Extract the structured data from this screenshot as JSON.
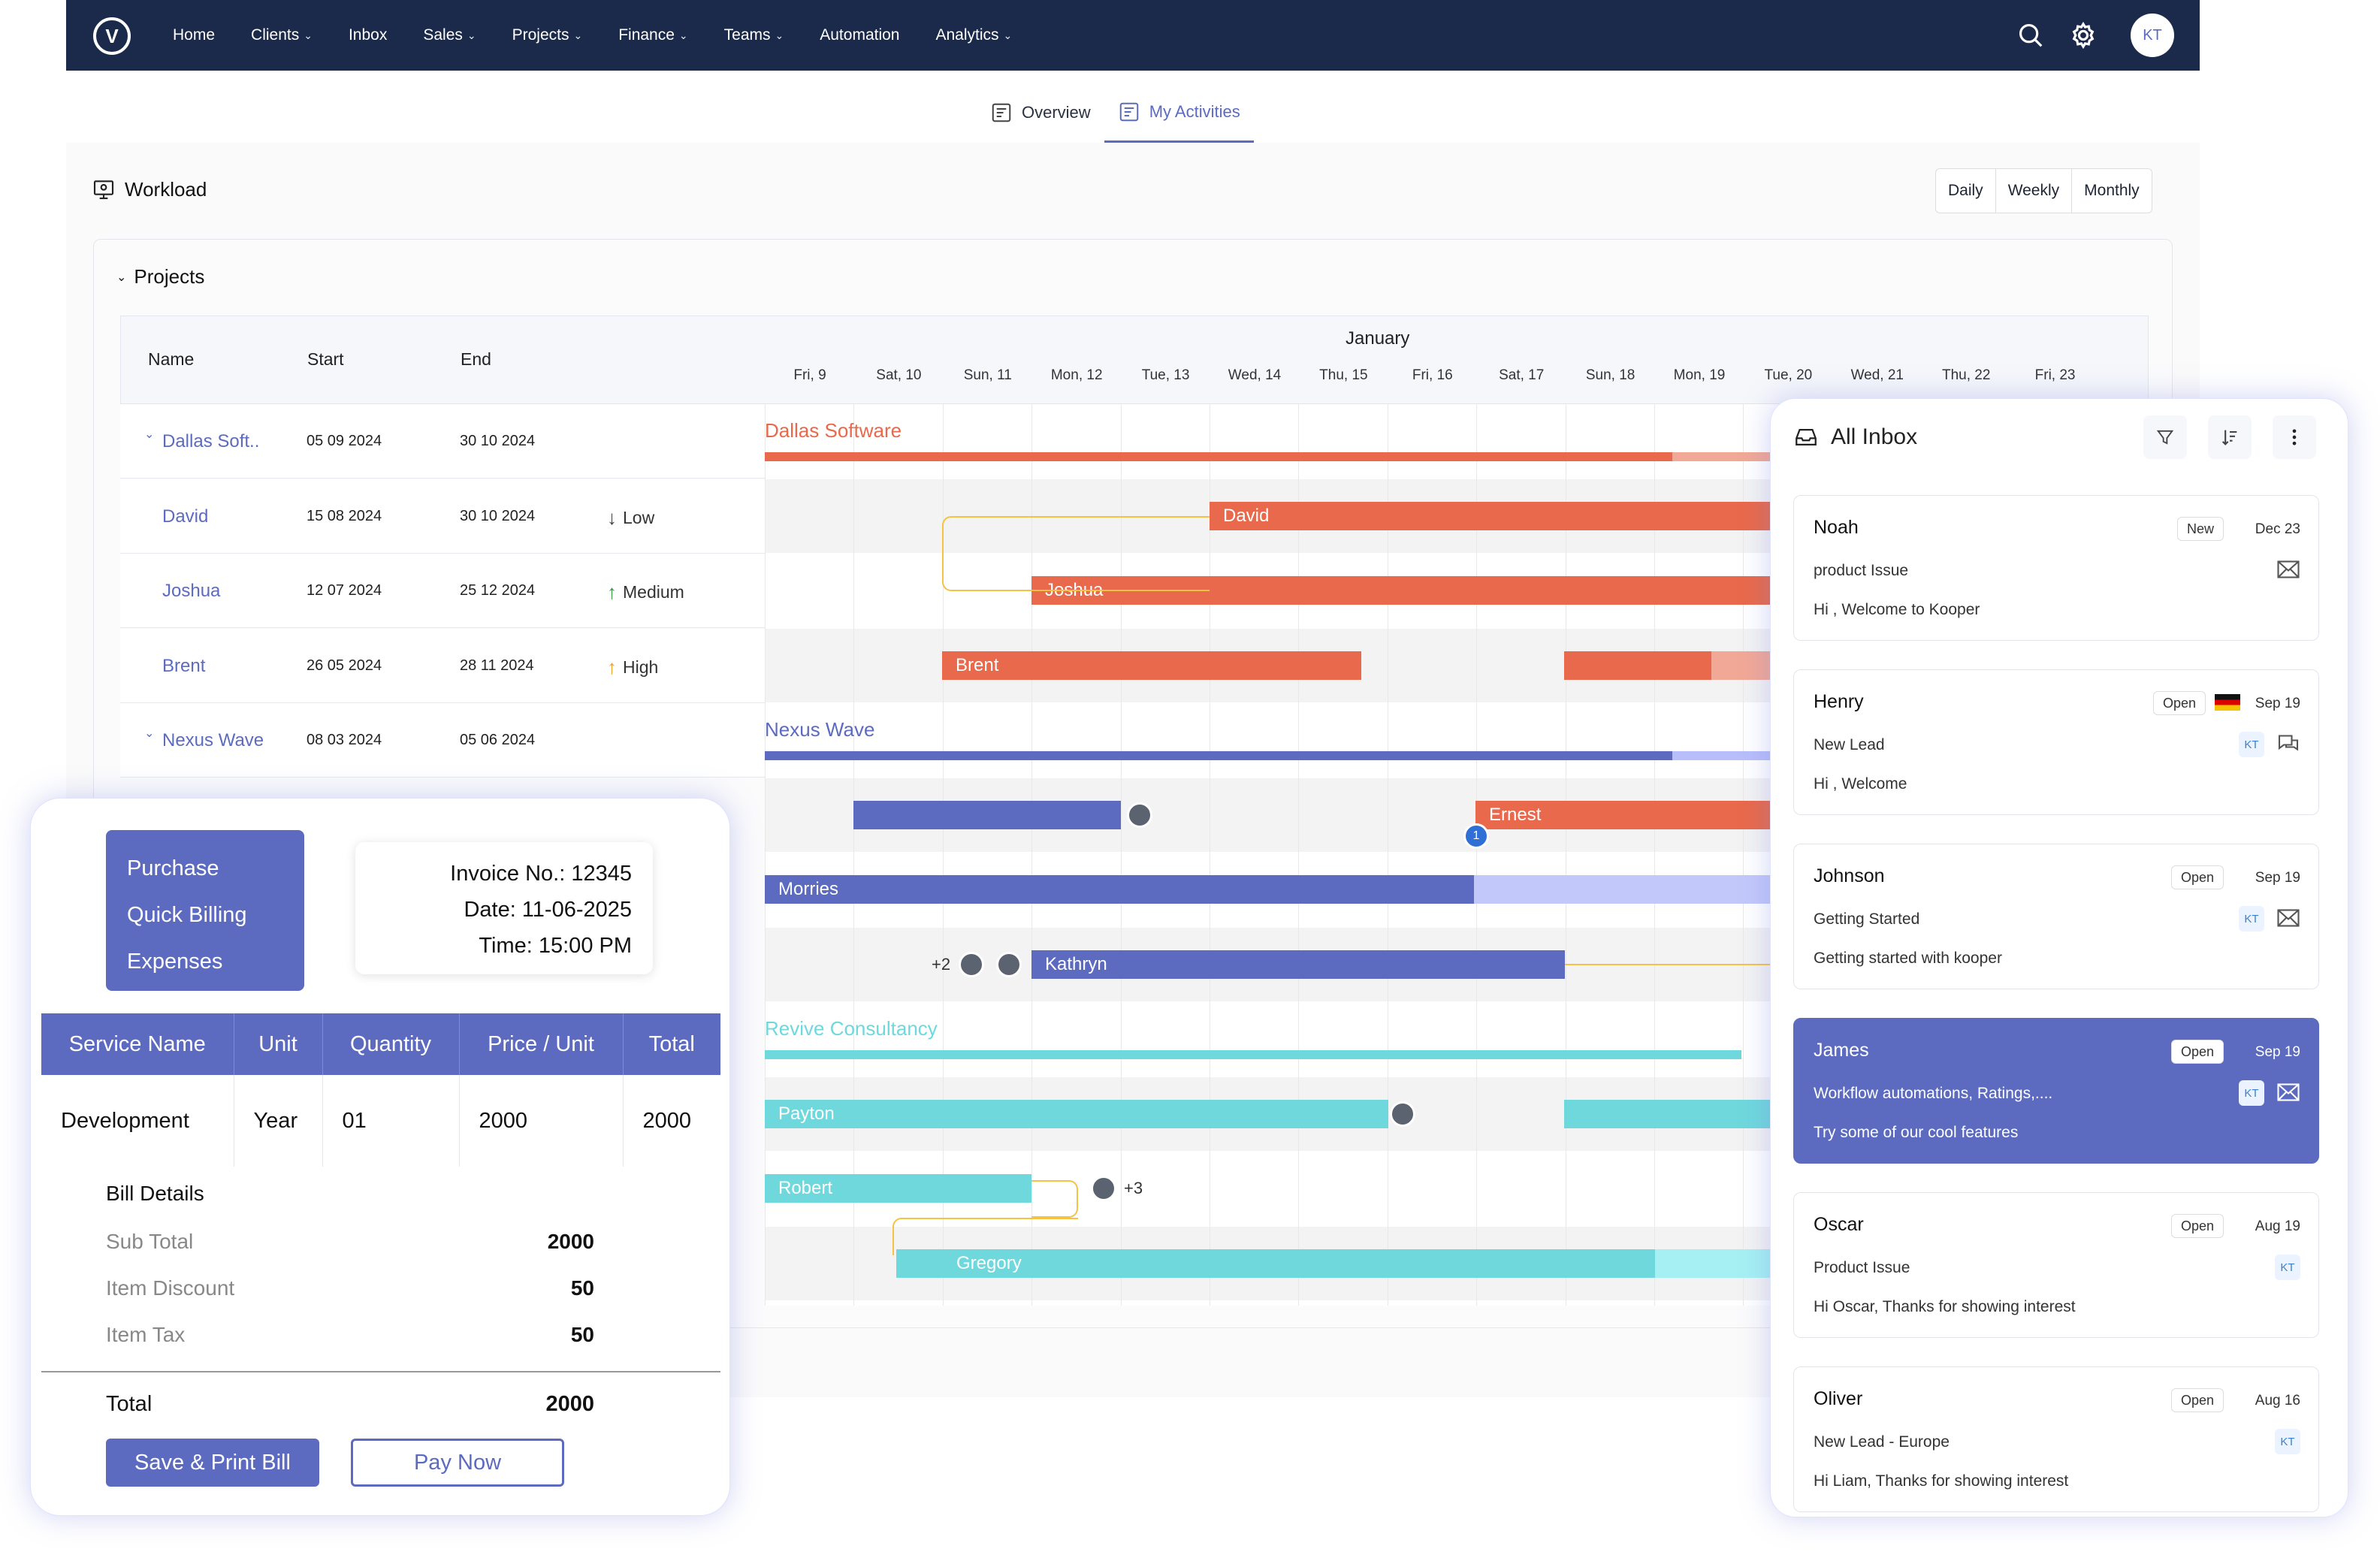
{
  "nav": {
    "logo": "V",
    "items": [
      {
        "label": "Home",
        "dropdown": false
      },
      {
        "label": "Clients",
        "dropdown": true
      },
      {
        "label": "Inbox",
        "dropdown": false
      },
      {
        "label": "Sales",
        "dropdown": true
      },
      {
        "label": "Projects",
        "dropdown": true
      },
      {
        "label": "Finance",
        "dropdown": true
      },
      {
        "label": "Teams",
        "dropdown": true
      },
      {
        "label": "Automation",
        "dropdown": false
      },
      {
        "label": "Analytics",
        "dropdown": true
      }
    ],
    "avatar": "KT"
  },
  "tabs": {
    "overview": "Overview",
    "activities": "My Activities"
  },
  "workload": {
    "title": "Workload",
    "periods": [
      "Daily",
      "Weekly",
      "Monthly"
    ],
    "projects_title": "Projects"
  },
  "gantt": {
    "headers": {
      "name": "Name",
      "start": "Start",
      "end": "End"
    },
    "month": "January",
    "days": [
      "Fri, 9",
      "Sat, 10",
      "Sun, 11",
      "Mon, 12",
      "Tue, 13",
      "Wed, 14",
      "Thu, 15",
      "Fri, 16",
      "Sat, 17",
      "Sun, 18",
      "Mon, 19",
      "Tue, 20",
      "Wed, 21",
      "Thu, 22",
      "Fri, 23"
    ],
    "rows": [
      {
        "name": "Dallas Soft..",
        "start": "05 09 2024",
        "end": "30 10 2024",
        "priority": "",
        "group": true
      },
      {
        "name": "David",
        "start": "15 08 2024",
        "end": "30 10 2024",
        "priority": "Low",
        "group": false
      },
      {
        "name": "Joshua",
        "start": "12 07 2024",
        "end": "25 12 2024",
        "priority": "Medium",
        "group": false
      },
      {
        "name": "Brent",
        "start": "26 05 2024",
        "end": "28 11 2024",
        "priority": "High",
        "group": false
      },
      {
        "name": "Nexus Wave",
        "start": "08 03 2024",
        "end": "05 06 2024",
        "priority": "",
        "group": true
      }
    ],
    "groups": [
      "Dallas Software",
      "Nexus Wave",
      "Revive Consultancy"
    ],
    "bars": [
      "David",
      "Joshua",
      "Brent",
      "Ernest",
      "Morries",
      "Kathryn",
      "Payton",
      "Robert",
      "Gregory"
    ],
    "badge_count": "1",
    "more_left": "+2",
    "more_right": "+3",
    "colors": {
      "dallas": "#e8694b",
      "nexus": "#5c6bc0",
      "revive": "#6fd8dc"
    }
  },
  "inbox": {
    "title": "All Inbox",
    "cards": [
      {
        "name": "Noah",
        "status": "New",
        "date": "Dec 23",
        "subject": "product Issue",
        "message": "Hi , Welcome to Kooper",
        "kt": "",
        "icon": "mail-icon"
      },
      {
        "name": "Henry",
        "status": "Open",
        "date": "Sep 19",
        "subject": "New Lead",
        "message": "Hi , Welcome",
        "kt": "KT",
        "icon": "chat-icon"
      },
      {
        "name": "Johnson",
        "status": "Open",
        "date": "Sep 19",
        "subject": "Getting Started",
        "message": "Getting started with kooper",
        "kt": "KT",
        "icon": "mail-icon"
      },
      {
        "name": "James",
        "status": "Open",
        "date": "Sep 19",
        "subject": "Workflow automations, Ratings,....",
        "message": "Try some of our cool features",
        "kt": "KT",
        "icon": "mail-icon"
      },
      {
        "name": "Oscar",
        "status": "Open",
        "date": "Aug 19",
        "subject": "Product Issue",
        "message": "Hi Oscar, Thanks for showing interest",
        "kt": "KT",
        "icon": ""
      },
      {
        "name": "Oliver",
        "status": "Open",
        "date": "Aug 16",
        "subject": "New Lead - Europe",
        "message": "Hi Liam, Thanks for showing interest",
        "kt": "KT",
        "icon": ""
      }
    ]
  },
  "invoice": {
    "menu": [
      "Purchase",
      "Quick Billing",
      "Expenses"
    ],
    "number": "Invoice No.: 12345",
    "date": "Date: 11-06-2025",
    "time": "Time: 15:00 PM",
    "columns": [
      "Service Name",
      "Unit",
      "Quantity",
      "Price / Unit",
      "Total"
    ],
    "row": [
      "Development",
      "Year",
      "01",
      "2000",
      "2000"
    ],
    "bill_title": "Bill Details",
    "sub_total_label": "Sub Total",
    "sub_total": "2000",
    "discount_label": "Item Discount",
    "discount": "50",
    "tax_label": "Item Tax",
    "tax": "50",
    "total_label": "Total",
    "total": "2000",
    "save_button": "Save & Print Bill",
    "pay_button": "Pay Now"
  }
}
